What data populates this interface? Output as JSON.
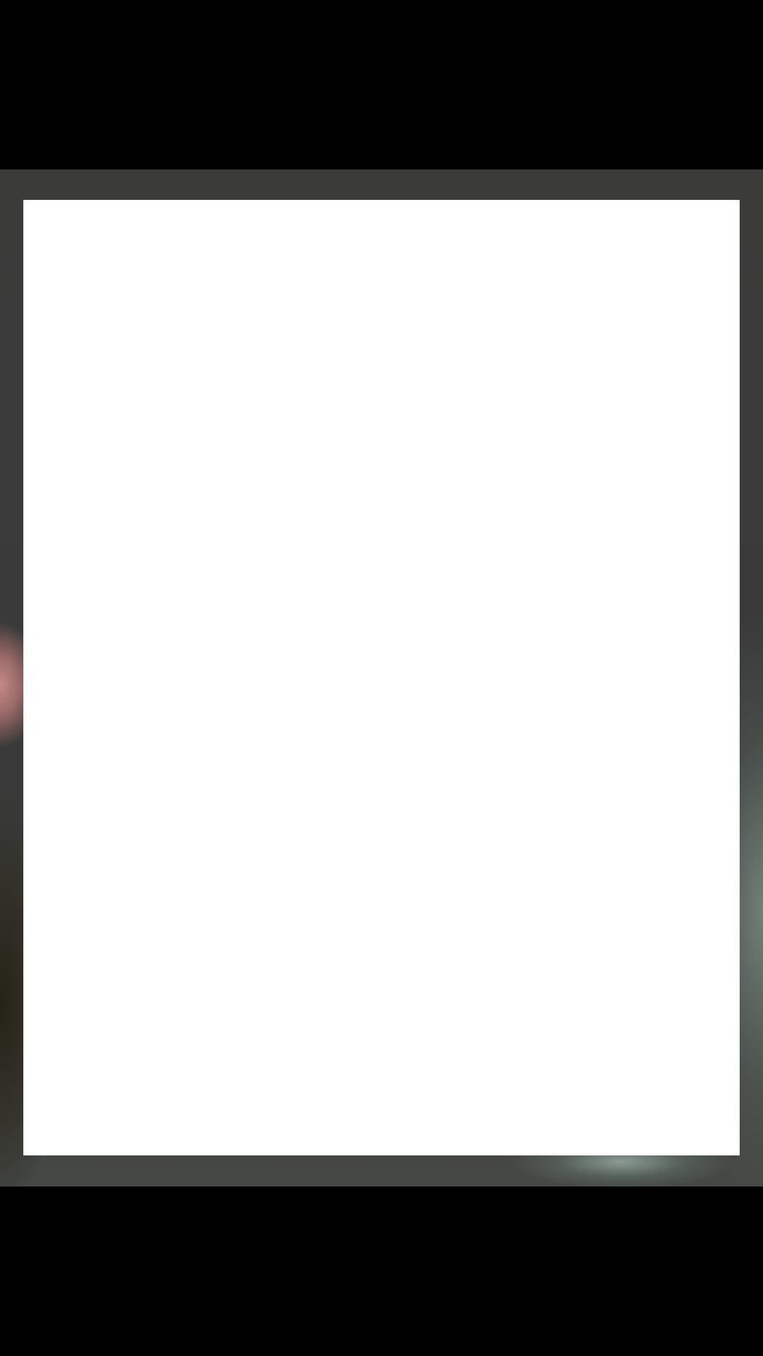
{
  "screen": {
    "background_color": "#000000"
  },
  "camera_preview": {
    "frame_color": "#ffffff",
    "surround_color": "#3a3b3a"
  }
}
